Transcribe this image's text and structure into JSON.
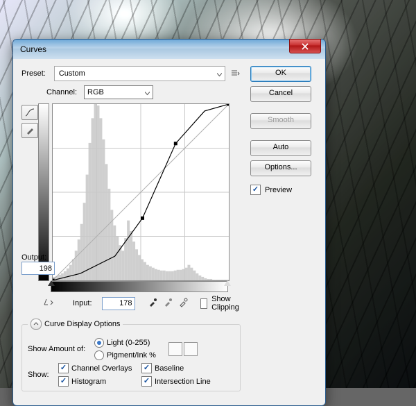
{
  "window": {
    "title": "Curves"
  },
  "preset": {
    "label": "Preset:",
    "value": "Custom"
  },
  "channel": {
    "label": "Channel:",
    "value": "RGB"
  },
  "output": {
    "label": "Output:",
    "value": "198"
  },
  "input": {
    "label": "Input:",
    "value": "178"
  },
  "show_clipping": "Show Clipping",
  "buttons": {
    "ok": "OK",
    "cancel": "Cancel",
    "smooth": "Smooth",
    "auto": "Auto",
    "options": "Options..."
  },
  "preview": {
    "label": "Preview",
    "checked": true
  },
  "curve_display": {
    "legend": "Curve Display Options",
    "show_amount": "Show Amount of:",
    "light": "Light  (0-255)",
    "pigment": "Pigment/Ink %",
    "show": "Show:",
    "channel_overlays": "Channel Overlays",
    "histogram": "Histogram",
    "baseline": "Baseline",
    "intersection": "Intersection Line"
  },
  "chart_data": {
    "type": "line",
    "title": "Curves",
    "xlabel": "Input",
    "ylabel": "Output",
    "xlim": [
      0,
      255
    ],
    "ylim": [
      0,
      255
    ],
    "grid": true,
    "series": [
      {
        "name": "baseline",
        "x": [
          0,
          255
        ],
        "y": [
          0,
          255
        ]
      },
      {
        "name": "curve",
        "x": [
          0,
          40,
          90,
          130,
          178,
          220,
          255
        ],
        "y": [
          0,
          10,
          35,
          90,
          198,
          245,
          255
        ]
      }
    ],
    "control_points": [
      {
        "x": 0,
        "y": 0
      },
      {
        "x": 130,
        "y": 90
      },
      {
        "x": 178,
        "y": 198
      },
      {
        "x": 255,
        "y": 255
      }
    ],
    "histogram": [
      5,
      6,
      8,
      10,
      13,
      17,
      22,
      30,
      42,
      58,
      80,
      110,
      150,
      195,
      230,
      250,
      248,
      230,
      200,
      165,
      130,
      100,
      78,
      62,
      50,
      42,
      60,
      85,
      70,
      55,
      44,
      36,
      30,
      26,
      22,
      20,
      18,
      16,
      15,
      14,
      14,
      13,
      13,
      13,
      14,
      15,
      15,
      16,
      18,
      22,
      18,
      14,
      10,
      7,
      5,
      3,
      2,
      2,
      1,
      1,
      1,
      1,
      1,
      1
    ]
  }
}
